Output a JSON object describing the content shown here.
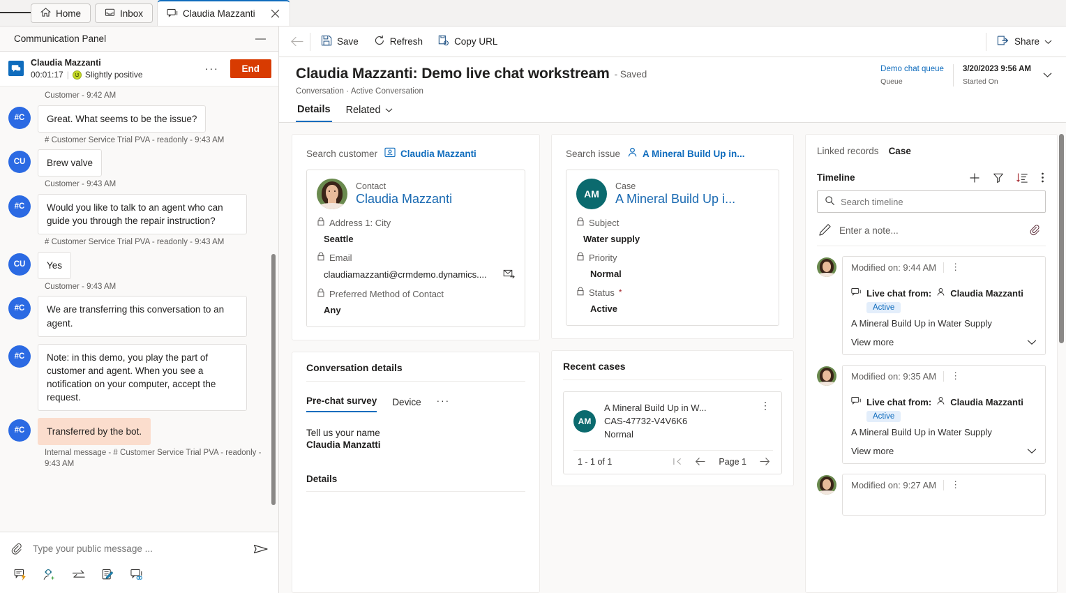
{
  "tabstrip": {
    "menu_label": "Menu",
    "tabs": [
      {
        "label": "Home",
        "icon": "home-icon",
        "active": false
      },
      {
        "label": "Inbox",
        "icon": "inbox-icon",
        "active": false
      },
      {
        "label": "Claudia Mazzanti",
        "icon": "chat-icon",
        "active": true
      }
    ],
    "close_label": "✕"
  },
  "comm_panel": {
    "title": "Communication Panel",
    "minimize_label": "—",
    "session": {
      "name": "Claudia Mazzanti",
      "timer": "00:01:17",
      "separator": "|",
      "sentiment": "Slightly positive",
      "more_label": "···",
      "end_label": "End"
    },
    "messages": [
      {
        "type": "meta",
        "text": "Customer - 9:42 AM"
      },
      {
        "type": "message",
        "avatar": "#C",
        "text": "Great. What seems to be the issue?",
        "internal": false
      },
      {
        "type": "meta",
        "text": "# Customer Service Trial PVA - readonly - 9:43 AM"
      },
      {
        "type": "message",
        "avatar": "CU",
        "text": "Brew valve",
        "internal": false
      },
      {
        "type": "meta",
        "text": "Customer - 9:43 AM"
      },
      {
        "type": "message",
        "avatar": "#C",
        "text": "Would you like to talk to an agent who can guide you through the repair instruction?",
        "internal": false
      },
      {
        "type": "meta",
        "text": "# Customer Service Trial PVA - readonly - 9:43 AM"
      },
      {
        "type": "message",
        "avatar": "CU",
        "text": "Yes",
        "internal": false
      },
      {
        "type": "meta",
        "text": "Customer - 9:43 AM"
      },
      {
        "type": "message",
        "avatar": "#C",
        "text": "We are transferring this conversation to an agent.",
        "internal": false
      },
      {
        "type": "message",
        "avatar": "#C",
        "text": "Note: in this demo, you play the part of customer and agent. When you see a notification on your computer, accept the request.",
        "internal": false
      },
      {
        "type": "message",
        "avatar": "#C",
        "text": "Transferred by the bot.",
        "internal": true
      },
      {
        "type": "meta",
        "text": "Internal message - # Customer Service Trial PVA - readonly - 9:43 AM"
      }
    ],
    "composer": {
      "placeholder": "Type your public message ...",
      "attach_label": "attachment-icon",
      "send_label": "send-icon"
    },
    "tools": [
      "quick-replies-icon",
      "consult-icon",
      "transfer-icon",
      "notes-icon",
      "linked-conversation-icon"
    ]
  },
  "commandbar": {
    "back_label": "←",
    "buttons": [
      {
        "label": "Save",
        "icon": "save-icon"
      },
      {
        "label": "Refresh",
        "icon": "refresh-icon"
      },
      {
        "label": "Copy URL",
        "icon": "copy-url-icon"
      }
    ],
    "share_label": "Share"
  },
  "record": {
    "title": "Claudia Mazzanti: Demo live chat workstream",
    "saved_suffix": "- Saved",
    "breadcrumb": "Conversation · Active Conversation",
    "header_fields": [
      {
        "value": "Demo chat queue",
        "label": "Queue",
        "link": true
      },
      {
        "value": "3/20/2023 9:56 AM",
        "label": "Started On",
        "link": false
      }
    ]
  },
  "tabs": [
    {
      "label": "Details",
      "active": true,
      "has_chevron": false
    },
    {
      "label": "Related",
      "active": false,
      "has_chevron": true
    }
  ],
  "customer_card": {
    "search_label": "Search customer",
    "search_value": "Claudia Mazzanti",
    "entity_type": "Contact",
    "entity_name": "Claudia Mazzanti",
    "fields": [
      {
        "label": "Address 1: City",
        "value": "Seattle",
        "has_action": false
      },
      {
        "label": "Email",
        "value": "claudiamazzanti@crmdemo.dynamics....",
        "has_action": true
      },
      {
        "label": "Preferred Method of Contact",
        "value": "Any",
        "has_action": false
      }
    ]
  },
  "issue_card": {
    "search_label": "Search issue",
    "search_value": "A Mineral Build Up in...",
    "entity_type": "Case",
    "entity_initials": "AM",
    "entity_name": "A Mineral Build Up i...",
    "fields": [
      {
        "label": "Subject",
        "value": "Water supply",
        "required": false
      },
      {
        "label": "Priority",
        "value": "Normal",
        "required": false
      },
      {
        "label": "Status",
        "value": "Active",
        "required": true
      }
    ]
  },
  "conversation_details": {
    "title": "Conversation details",
    "tabs": [
      {
        "label": "Pre-chat survey",
        "active": true
      },
      {
        "label": "Device",
        "active": false
      },
      {
        "label": "···",
        "active": false
      }
    ],
    "survey": [
      {
        "question": "Tell us your name",
        "answer": "Claudia Manzatti"
      }
    ],
    "details_heading": "Details"
  },
  "recent_cases": {
    "title": "Recent cases",
    "items": [
      {
        "initials": "AM",
        "title": "A Mineral Build Up in W...",
        "number": "CAS-47732-V4V6K6",
        "priority": "Normal"
      }
    ],
    "pager": {
      "count": "1 - 1 of 1",
      "first_label": "first-page-icon",
      "prev_label": "previous-page-icon",
      "page_label": "Page 1",
      "next_label": "next-page-icon"
    }
  },
  "timeline_panel": {
    "linked_records_label": "Linked records",
    "linked_records_value": "Case",
    "title": "Timeline",
    "actions": [
      "add-icon",
      "filter-icon",
      "sort-icon",
      "more-icon"
    ],
    "search_placeholder": "Search timeline",
    "note_placeholder": "Enter a note...",
    "note_attach": "attachment-icon",
    "items": [
      {
        "modified": "Modified on: 9:44 AM",
        "from_label": "Live chat from:",
        "from_name": "Claudia Mazzanti",
        "badge": "Active",
        "subject": "A Mineral Build Up in Water Supply",
        "view_more": "View more"
      },
      {
        "modified": "Modified on: 9:35 AM",
        "from_label": "Live chat from:",
        "from_name": "Claudia Mazzanti",
        "badge": "Active",
        "subject": "A Mineral Build Up in Water Supply",
        "view_more": "View more"
      },
      {
        "modified": "Modified on: 9:27 AM",
        "from_label": "",
        "from_name": "",
        "badge": "",
        "subject": "",
        "view_more": ""
      }
    ]
  },
  "colors": {
    "accent": "#0f6cbd",
    "danger": "#d83b01",
    "avatar_blue": "#2b6ae3",
    "case_teal": "#0b6a6e",
    "internal_bg": "#fbddcd"
  }
}
